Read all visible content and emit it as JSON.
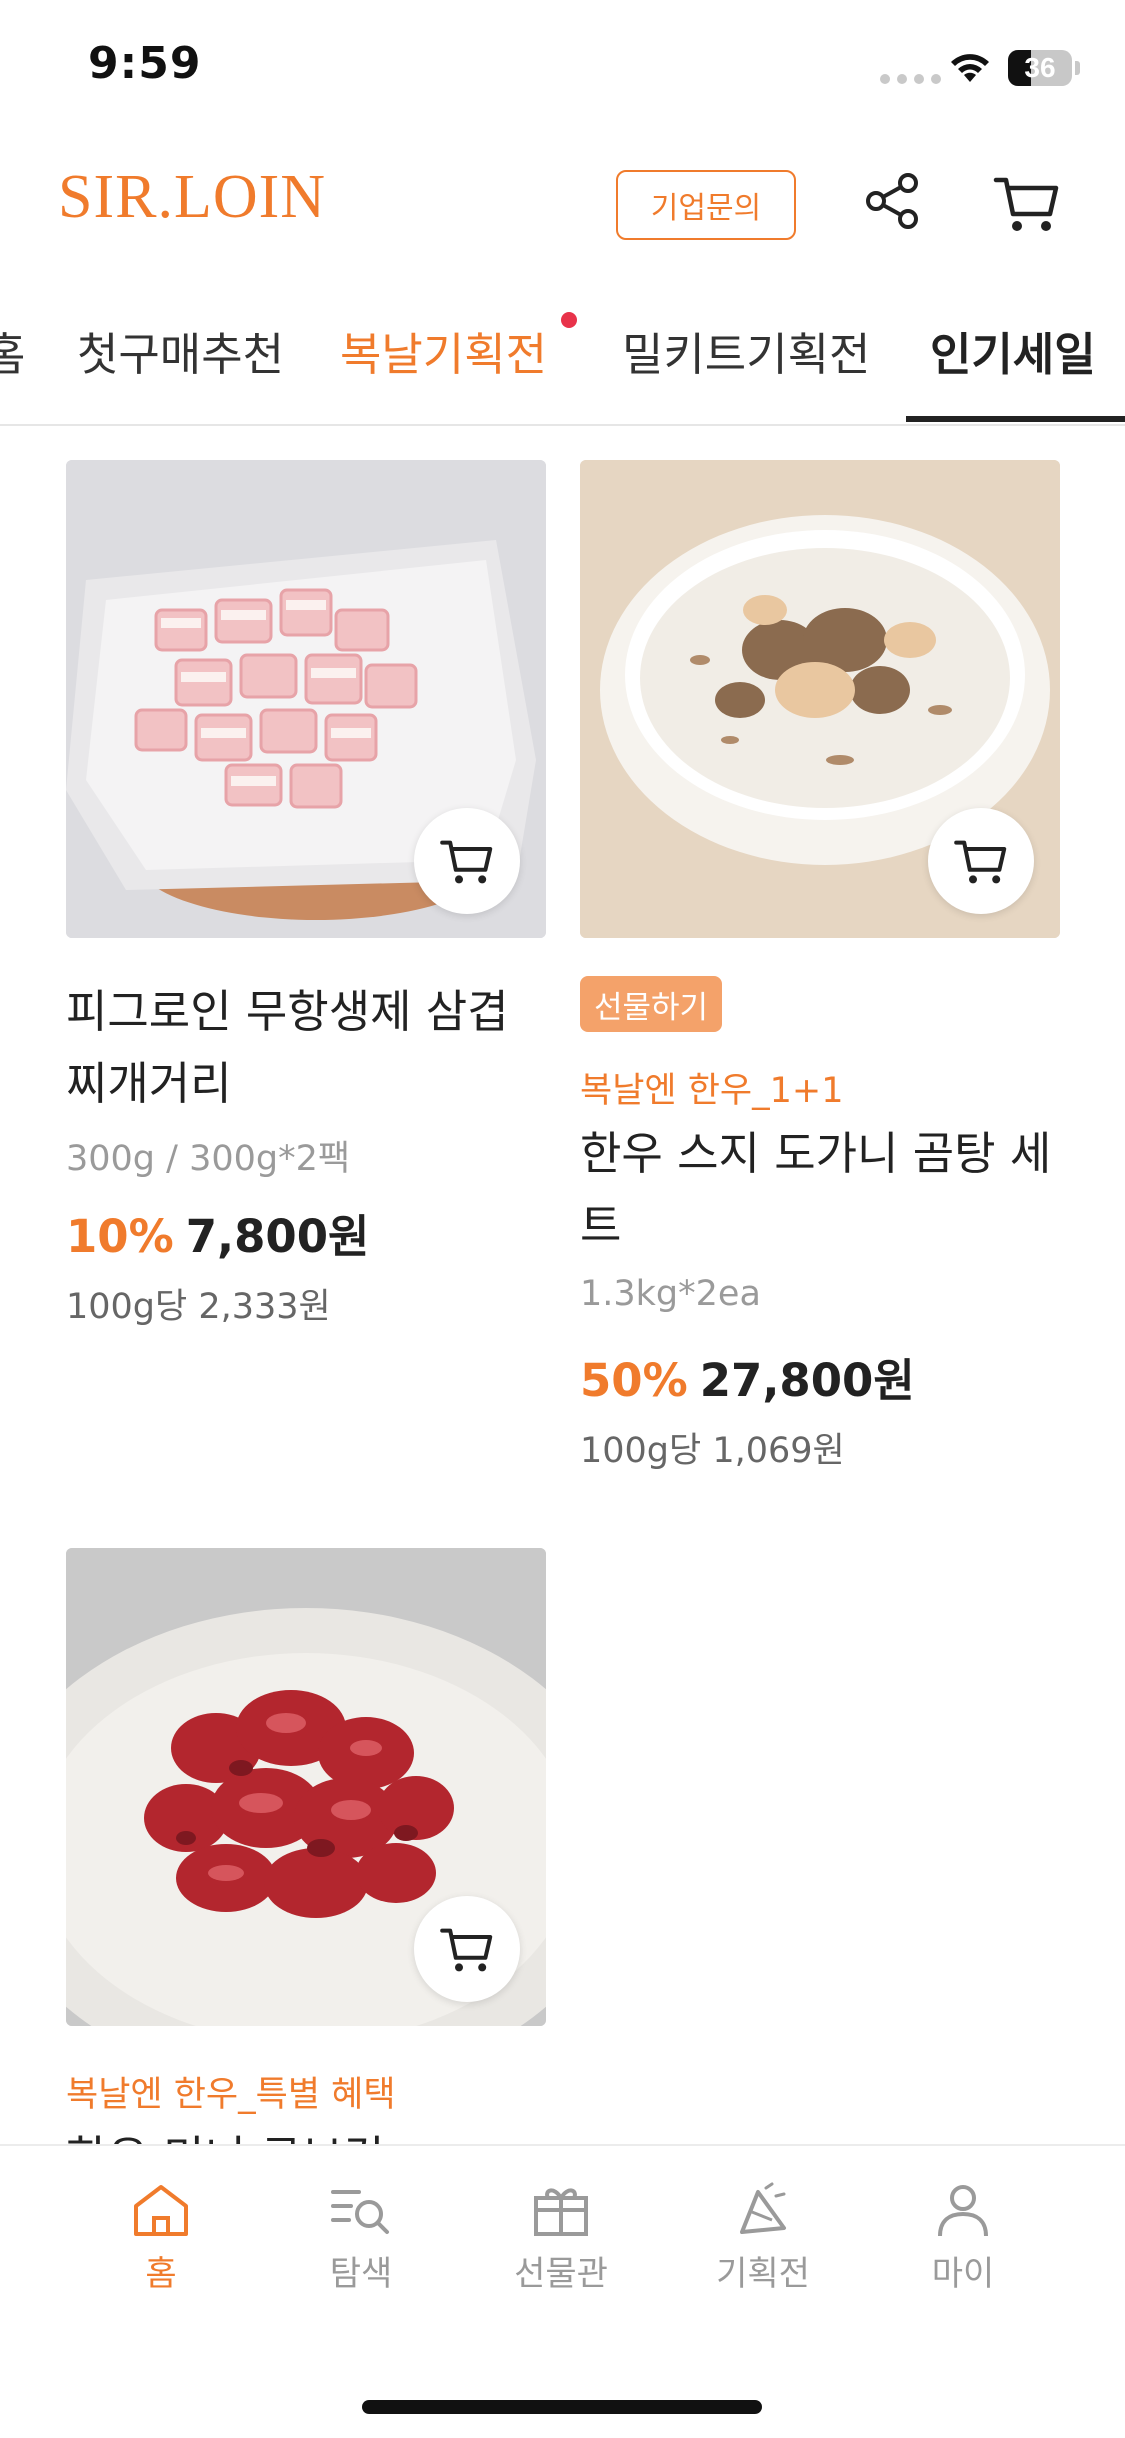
{
  "status_bar": {
    "time": "9:59",
    "battery": "36",
    "battery_level": 0.36
  },
  "header": {
    "logo": "SIR.LOIN",
    "biz_inquiry": "기업문의",
    "icons": [
      "share-icon",
      "cart-icon"
    ],
    "brand_color": "#f07b2c"
  },
  "tabs": [
    {
      "label": "홈",
      "state": "normal"
    },
    {
      "label": "첫구매추천",
      "state": "normal"
    },
    {
      "label": "복날기획전",
      "state": "highlight",
      "badge_dot": true
    },
    {
      "label": "밀키트기획전",
      "state": "normal"
    },
    {
      "label": "인기세일",
      "state": "selected"
    }
  ],
  "products": [
    {
      "title_line1": "피그로인 무항생제 삼겹",
      "title_line2": "찌개거리",
      "option": "300g / 300g*2팩",
      "discount": "10%",
      "price": "7,800원",
      "unit_price": "100g당 2,333원"
    },
    {
      "badge": "선물하기",
      "promo": "복날엔 한우_1+1",
      "title_line1": "한우 스지 도가니 곰탕 세",
      "title_line2": "트",
      "option": "1.3kg*2ea",
      "discount": "50%",
      "price": "27,800원",
      "unit_price": "100g당 1,069원"
    },
    {
      "promo": "복날엔 한우_특별 혜택",
      "title_line1": "한우 미니 큐브컷"
    }
  ],
  "bottom_nav": [
    {
      "label": "홈",
      "icon": "home-icon",
      "active": true
    },
    {
      "label": "탐색",
      "icon": "search-list-icon",
      "active": false
    },
    {
      "label": "선물관",
      "icon": "gift-icon",
      "active": false
    },
    {
      "label": "기획전",
      "icon": "party-icon",
      "active": false
    },
    {
      "label": "마이",
      "icon": "person-icon",
      "active": false
    }
  ]
}
